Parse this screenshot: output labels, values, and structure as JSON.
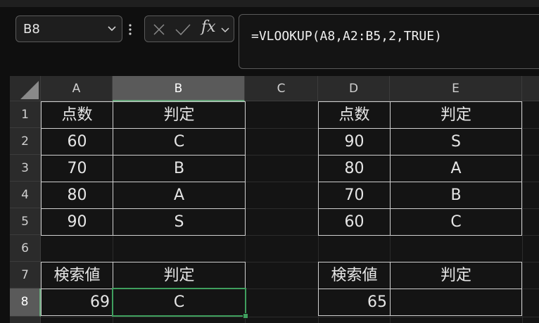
{
  "name_box": {
    "value": "B8"
  },
  "formula_bar": {
    "formula": "=VLOOKUP(A8,A2:B5,2,TRUE)",
    "fx_label": "fx"
  },
  "columns": [
    "A",
    "B",
    "C",
    "D",
    "E"
  ],
  "selected_column": "B",
  "rows": [
    "1",
    "2",
    "3",
    "4",
    "5",
    "6",
    "7",
    "8"
  ],
  "selected_row": "8",
  "cells": {
    "A1": "点数",
    "B1": "判定",
    "A2": "60",
    "B2": "C",
    "A3": "70",
    "B3": "B",
    "A4": "80",
    "B4": "A",
    "A5": "90",
    "B5": "S",
    "A7": "検索値",
    "B7": "判定",
    "A8": "69",
    "B8": "C",
    "D1": "点数",
    "E1": "判定",
    "D2": "90",
    "E2": "S",
    "D3": "80",
    "E3": "A",
    "D4": "70",
    "E4": "B",
    "D5": "60",
    "E5": "C",
    "D7": "検索値",
    "E7": "判定",
    "D8": "65",
    "E8": ""
  },
  "colors": {
    "selection": "#3f9f5e",
    "header_bg": "#2b2b2b",
    "cell_bg": "#141414"
  }
}
